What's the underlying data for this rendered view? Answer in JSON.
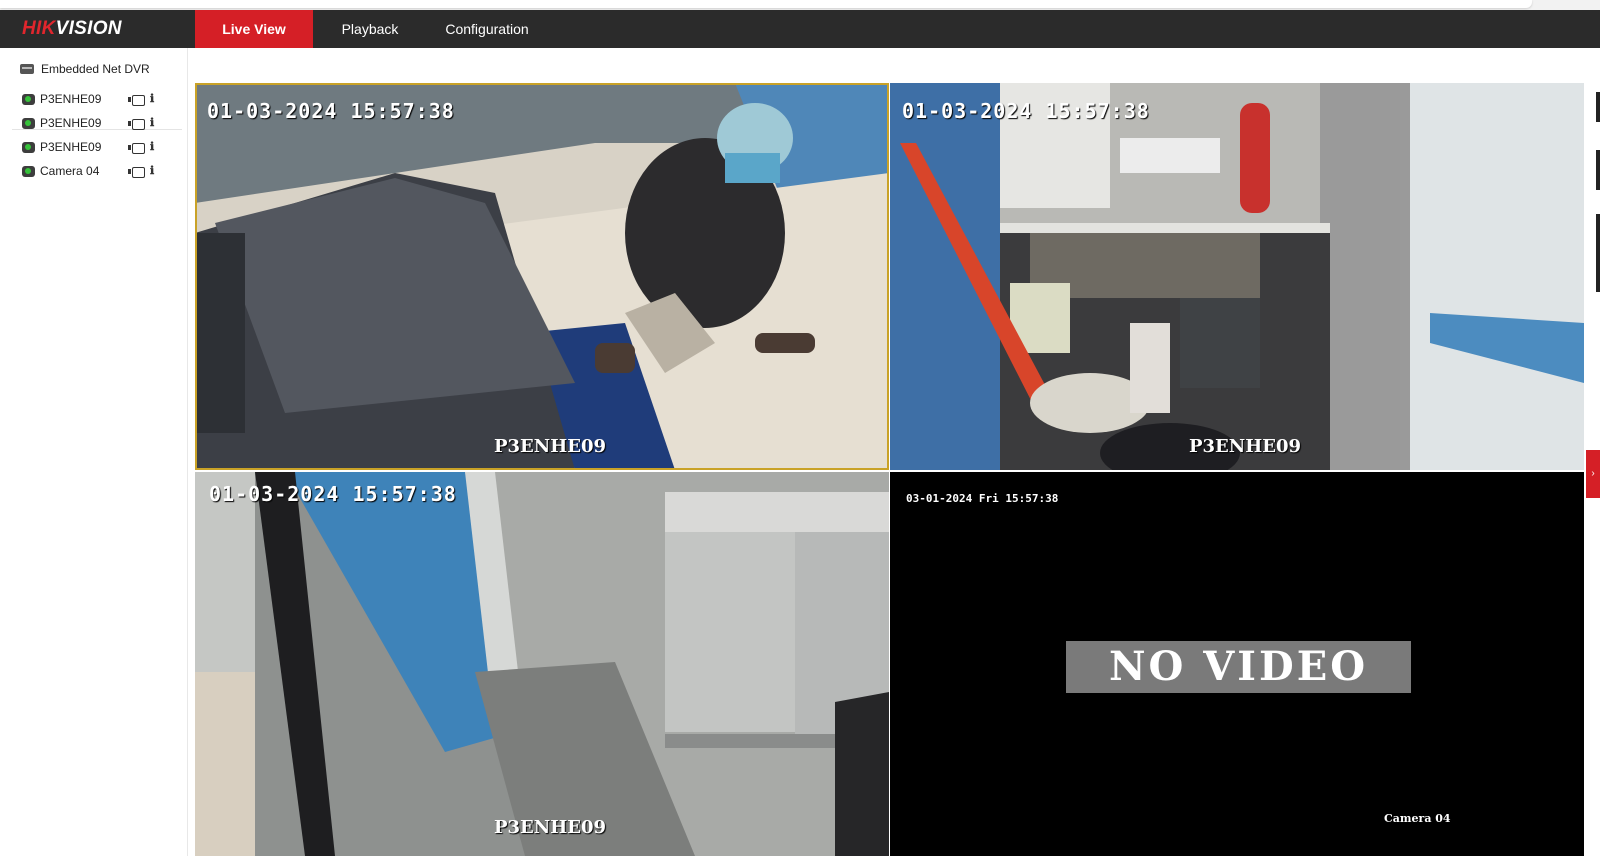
{
  "brand": {
    "logo_red": "HIK",
    "logo_white": "VISION",
    "accent_color": "#d51f26",
    "navbar_color": "#2b2b2b"
  },
  "nav": {
    "tabs": [
      {
        "label": "Live View",
        "active": true
      },
      {
        "label": "Playback",
        "active": false
      },
      {
        "label": "Configuration",
        "active": false
      }
    ]
  },
  "sidebar": {
    "device_icon": "dvr-icon",
    "device_label": "Embedded Net DVR",
    "cameras": [
      {
        "label": "P3ENHE09",
        "status_icon": "camera-online-icon",
        "record_icon": "record-icon",
        "info_icon": "channel-info-icon"
      },
      {
        "label": "P3ENHE09",
        "status_icon": "camera-online-icon",
        "record_icon": "record-icon",
        "info_icon": "channel-info-icon"
      },
      {
        "label": "P3ENHE09",
        "status_icon": "camera-online-icon",
        "record_icon": "record-icon",
        "info_icon": "channel-info-icon"
      },
      {
        "label": "Camera 04",
        "status_icon": "camera-online-icon",
        "record_icon": "record-icon",
        "info_icon": "channel-info-icon"
      }
    ]
  },
  "panes": [
    {
      "timestamp": "01-03-2024 15:57:38",
      "camera_name": "P3ENHE09",
      "selected": true
    },
    {
      "timestamp": "01-03-2024 15:57:38",
      "camera_name": "P3ENHE09",
      "selected": false
    },
    {
      "timestamp": "01-03-2024 15:57:38",
      "camera_name": "P3ENHE09",
      "selected": false
    },
    {
      "timestamp": "03-01-2024 Fri 15:57:38",
      "camera_name": "Camera 04",
      "status": "NO VIDEO",
      "selected": false
    }
  ],
  "collapse_icon": "chevron-right-icon",
  "collapse_glyph": "›"
}
